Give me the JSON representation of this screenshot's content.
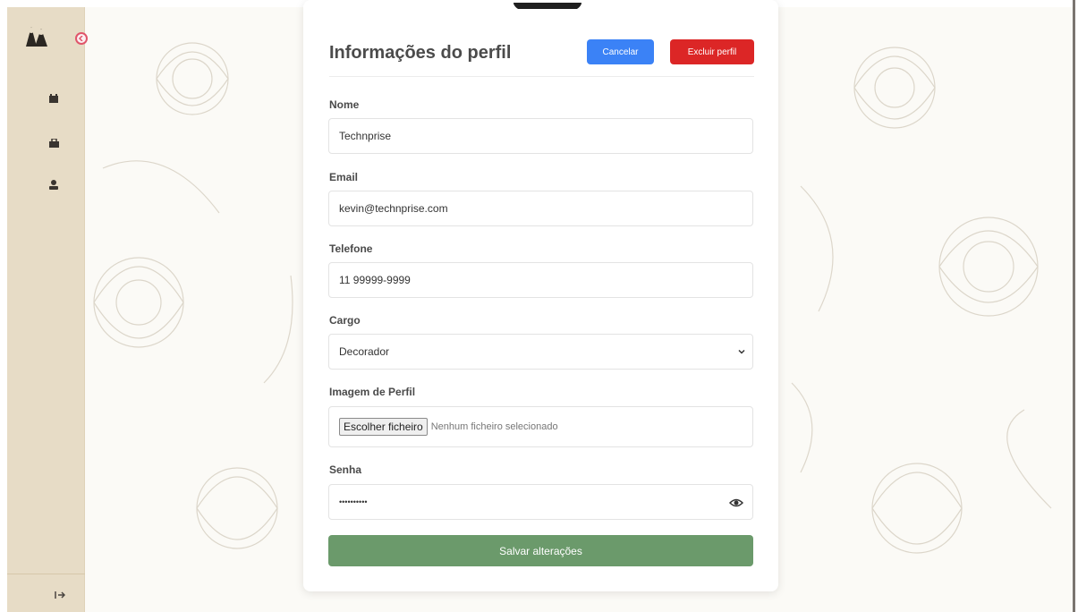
{
  "sidebar": {
    "items": [
      {
        "icon": "calendar-icon",
        "glyph": "📅"
      },
      {
        "icon": "briefcase-icon",
        "glyph": "💼"
      },
      {
        "icon": "user-icon",
        "glyph": "👤"
      }
    ],
    "logout_icon": "logout-icon"
  },
  "profile": {
    "title": "Informações do perfil",
    "cancel_label": "Cancelar",
    "delete_label": "Excluir perfil",
    "fields": {
      "name": {
        "label": "Nome",
        "value": "Technprise"
      },
      "email": {
        "label": "Email",
        "value": "kevin@technprise.com"
      },
      "phone": {
        "label": "Telefone",
        "value": "11 99999-9999"
      },
      "role": {
        "label": "Cargo",
        "value": "Decorador"
      },
      "image": {
        "label": "Imagem de Perfil",
        "button": "Escolher ficheiro",
        "status": "Nenhum ficheiro selecionado"
      },
      "password": {
        "label": "Senha",
        "value": "••••••••••"
      }
    },
    "save_label": "Salvar alterações"
  },
  "colors": {
    "sidebar_bg": "#e7dcc6",
    "cancel": "#3b82f6",
    "delete": "#dc2626",
    "save": "#6b9a6b"
  }
}
